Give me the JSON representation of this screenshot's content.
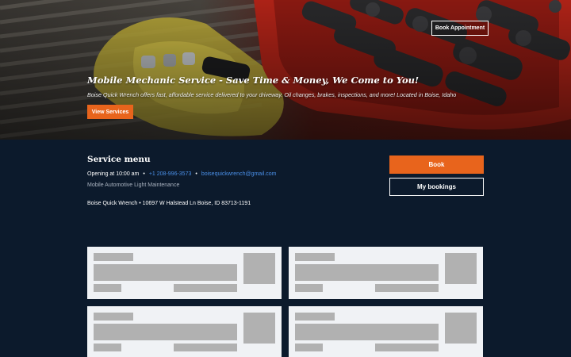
{
  "hero": {
    "title": "Mobile Mechanic Service - Save Time & Money, We Come to You!",
    "subtitle": "Boise Quick Wrench offers fast, affordable service delivered to your driveway. Oil changes, brakes, inspections, and more! Located in Boise, Idaho",
    "view_services_label": "View Services",
    "book_appointment_label": "Book Appointment"
  },
  "service_menu": {
    "heading": "Service menu",
    "opening": "Opening at 10:00 am",
    "phone": "+1 208-996-3573",
    "email": "boisequickwrench@gmail.com",
    "category": "Mobile Automotive Light Maintenance",
    "address": "Boise Quick Wrench • 10697 W Halstead Ln Boise, ID 83713-1191"
  },
  "actions": {
    "book_label": "Book",
    "my_bookings_label": "My bookings"
  },
  "colors": {
    "accent": "#e8641c",
    "background": "#0c1a2c",
    "link": "#4a8fe7",
    "card": "#f0f2f5",
    "skeleton": "#b1b1b1"
  }
}
